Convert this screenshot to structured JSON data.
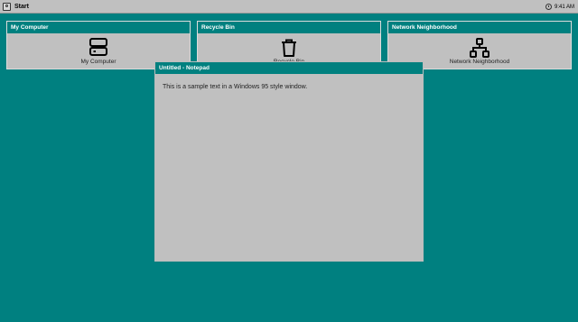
{
  "taskbar": {
    "start_label": "Start",
    "start_icon": "windows-logo-icon",
    "clock_icon": "clock-icon",
    "time": "9:41 AM"
  },
  "panels": [
    {
      "title": "My Computer",
      "label": "My Computer",
      "icon": "computer-icon"
    },
    {
      "title": "Recycle Bin",
      "label": "Recycle Bin",
      "icon": "trash-icon"
    },
    {
      "title": "Network Neighborhood",
      "label": "Network Neighborhood",
      "icon": "network-icon"
    }
  ],
  "window": {
    "title": "Untitled - Notepad",
    "content": "This is a sample text in a Windows 95 style window."
  },
  "colors": {
    "desktop": "#008080",
    "title_bar": "#00807f",
    "chrome": "#c0c0c0"
  }
}
